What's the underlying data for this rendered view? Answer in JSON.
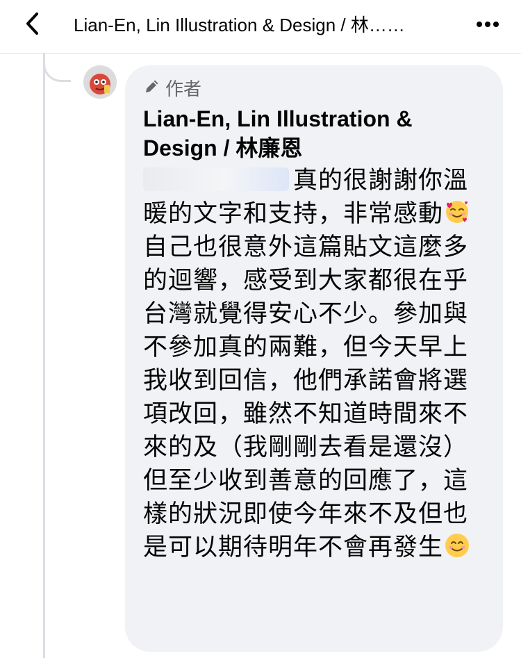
{
  "header": {
    "title": "Lian-En, Lin Illustration & Design / 林……",
    "back_icon": "chevron-left-icon",
    "more_icon": "more-horizontal-icon"
  },
  "comment": {
    "badge_icon": "pencil-icon",
    "badge_label": "作者",
    "author": "Lian-En, Lin Illustration & Design / 林廉恩",
    "mention_icon": "blurred-mention",
    "message_part1": "真的很謝謝你溫暖的文字和支持，非常感動",
    "emoji1": "smiling-face-with-hearts-emoji",
    "message_part2": "自己也很意外這篇貼文這麼多的迴響，感受到大家都很在乎台灣就覺得安心不少。參加與不參加真的兩難，但今天早上我收到回信，他們承諾會將選項改回，雖然不知道時間來不來的及（我剛剛去看是還沒）但至少收到善意的回應了，這樣的狀況即使今年來不及但也是可以期待明年不會再發生",
    "emoji2": "smiling-face-emoji"
  },
  "colors": {
    "bubble": "#f0f2f5",
    "text": "#050505",
    "secondary": "#65676b",
    "thread_line": "#dadde1"
  }
}
